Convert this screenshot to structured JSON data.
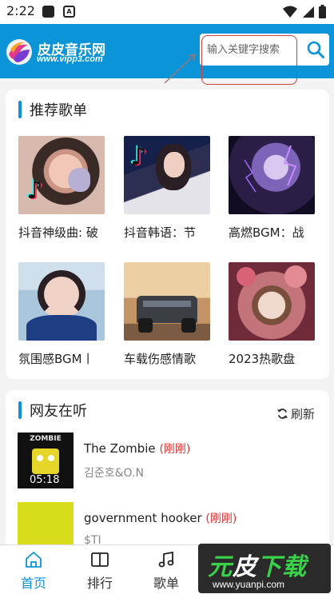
{
  "status_bar": {
    "time": "2:22",
    "notif_a": "A"
  },
  "header": {
    "site_name": "皮皮音乐网",
    "site_url": "www.vipp3.com",
    "search_placeholder": "输入关键字搜索"
  },
  "recommend": {
    "title": "推荐歌单",
    "items": [
      {
        "label": "抖音神级曲: 破"
      },
      {
        "label": "抖音韩语：节"
      },
      {
        "label": "高燃BGM：战"
      },
      {
        "label": "氛围感BGM丨"
      },
      {
        "label": "车载伤感情歌"
      },
      {
        "label": "2023热歌盘"
      }
    ]
  },
  "listening": {
    "title": "网友在听",
    "refresh_label": "刷新",
    "songs": [
      {
        "title": "The Zombie",
        "tag": "(刚刚)",
        "artist": "김준호&O.N",
        "duration": "05:18",
        "cover_text": "ZOMBIE"
      },
      {
        "title": "government hooker",
        "tag": "(刚刚)",
        "artist": "$TI",
        "duration": "",
        "cover_text": ""
      }
    ]
  },
  "nav": {
    "items": [
      {
        "label": "首页",
        "active": true
      },
      {
        "label": "排行"
      },
      {
        "label": "歌单"
      }
    ]
  },
  "watermark": {
    "text_a": "元",
    "text_b": "皮",
    "text_c": "下载",
    "url": "www.yuanpi.com"
  },
  "colors": {
    "brand": "#0b95d8",
    "tag_red": "#dd3333",
    "annotation": "#c8433b"
  }
}
